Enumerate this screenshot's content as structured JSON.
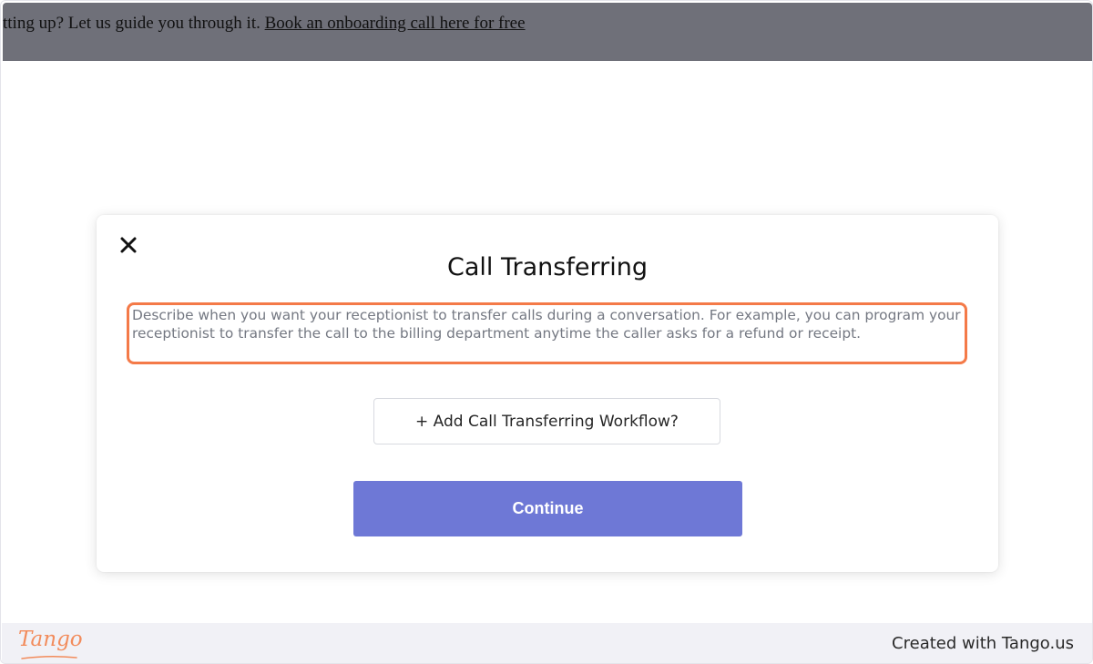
{
  "banner": {
    "text": "tting up? Let us guide you through it. ",
    "link_label": "Book an onboarding call here for free"
  },
  "modal": {
    "close_icon": "close-icon",
    "title": "Call Transferring",
    "description": "Describe when you want your receptionist to transfer calls during a conversation. For example, you can program your receptionist to transfer the call to the billing department anytime the caller asks for a refund or receipt.",
    "add_workflow_label": "+ Add Call Transferring Workflow?",
    "continue_label": "Continue"
  },
  "footer": {
    "logo_text": "Tango",
    "credit": "Created with Tango.us"
  },
  "colors": {
    "banner_bg": "#6f7079",
    "highlight": "#f47a48",
    "primary_button": "#6e78d6",
    "footer_bg": "#f1f1f6",
    "logo": "#f28c5c"
  }
}
